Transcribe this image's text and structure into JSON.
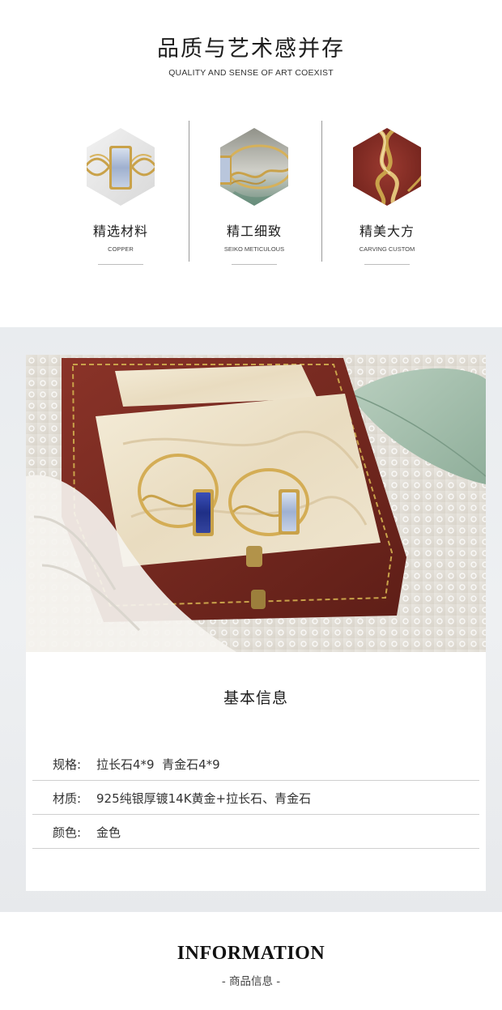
{
  "header": {
    "title": "品质与艺术感并存",
    "subtitle": "QUALITY AND SENSE OF ART COEXIST"
  },
  "features": [
    {
      "title": "精选材料",
      "subtitle": "COPPER",
      "icon": "ring-moonstone-icon"
    },
    {
      "title": "精工细致",
      "subtitle": "SEIKO METICULOUS",
      "icon": "ring-detail-icon"
    },
    {
      "title": "精美大方",
      "subtitle": "CARVING CUSTOM",
      "icon": "ring-twist-icon"
    }
  ],
  "photo": {
    "subject": "two gold rings in red jewelry box"
  },
  "basic_info": {
    "title": "基本信息",
    "rows": [
      {
        "label": "规格:",
        "value": "拉长石4*9  青金石4*9"
      },
      {
        "label": "材质:",
        "value": "925纯银厚镀14K黄金+拉长石、青金石"
      },
      {
        "label": "颜色:",
        "value": "金色"
      }
    ]
  },
  "footer": {
    "title": "INFORMATION",
    "subtitle": "- 商品信息 -"
  },
  "colors": {
    "gold": "#c9a24a",
    "box_red": "#7a2a22",
    "lapis": "#2e3f9e",
    "moonstone": "#a9b9d6",
    "section_bg": "#eceef1"
  }
}
